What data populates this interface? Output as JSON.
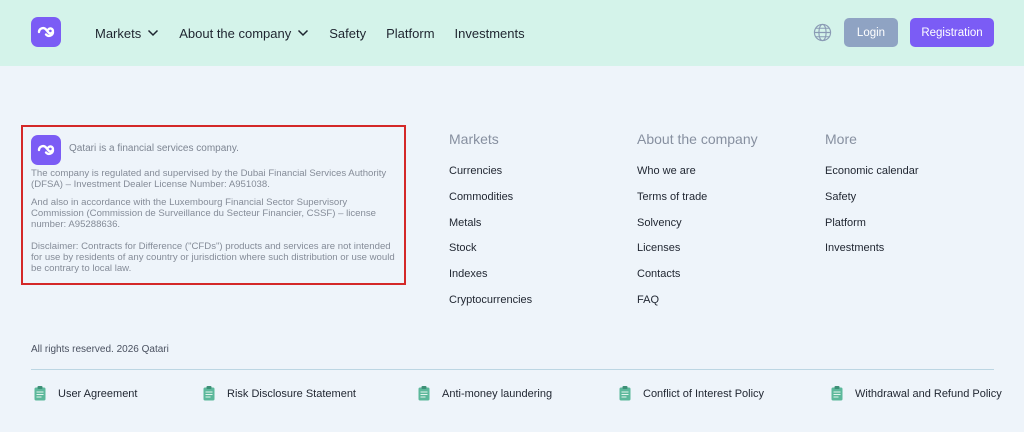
{
  "header": {
    "nav": [
      {
        "label": "Markets",
        "has_dropdown": true
      },
      {
        "label": "About the company",
        "has_dropdown": true
      },
      {
        "label": "Safety",
        "has_dropdown": false
      },
      {
        "label": "Platform",
        "has_dropdown": false
      },
      {
        "label": "Investments",
        "has_dropdown": false
      }
    ],
    "login_label": "Login",
    "registration_label": "Registration"
  },
  "company": {
    "tagline": "Qatari is a financial services company.",
    "paragraph_1": "The company is regulated and supervised by the Dubai Financial Services Authority (DFSA) – Investment Dealer License Number: A951038.",
    "paragraph_2": "And also in accordance with the Luxembourg Financial Sector Supervisory Commission (Commission de Surveillance du Secteur Financier, CSSF) – license number: A95288636.",
    "paragraph_3": "Disclaimer: Contracts for Difference (\"CFDs\") products and services are not intended for use by residents of any country or jurisdiction where such distribution or use would be contrary to local law."
  },
  "columns": {
    "markets": {
      "title": "Markets",
      "links": [
        "Currencies",
        "Commodities",
        "Metals",
        "Stock",
        "Indexes",
        "Cryptocurrencies"
      ]
    },
    "about": {
      "title": "About the company",
      "links": [
        "Who we are",
        "Terms of trade",
        "Solvency",
        "Licenses",
        "Contacts",
        "FAQ"
      ]
    },
    "more": {
      "title": "More",
      "links": [
        "Economic calendar",
        "Safety",
        "Platform",
        "Investments"
      ]
    }
  },
  "copyright": "All rights reserved. 2026 Qatari",
  "documents": [
    "User Agreement",
    "Risk Disclosure Statement",
    "Anti-money laundering",
    "Conflict of Interest Policy",
    "Withdrawal and Refund Policy"
  ],
  "colors": {
    "header_bg": "#d4f3ea",
    "page_bg": "#eef4fa",
    "brand": "#7b5cf5",
    "login_button": "#8fa3c3",
    "highlight_border": "#d42828"
  },
  "icons": {
    "logo": "brand-logo-icon",
    "dropdown": "chevron-down-icon",
    "language": "globe-icon",
    "document": "document-icon"
  }
}
